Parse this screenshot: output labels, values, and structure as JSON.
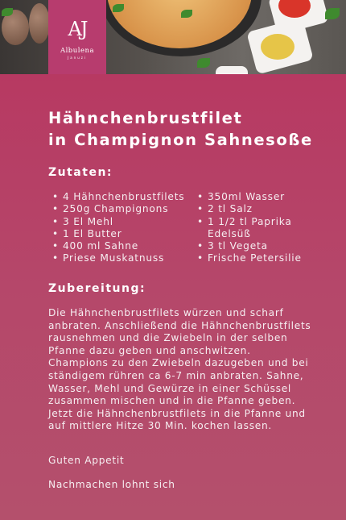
{
  "logo": {
    "monogram": "AJ",
    "name": "Albulena",
    "surname": "Januzi"
  },
  "title": {
    "line1": "Hähnchenbrustfilet",
    "line2": "in Champignon Sahnesoße"
  },
  "ingredients": {
    "heading": "Zutaten:",
    "column1": [
      "4 Hähnchenbrustfilets",
      "250g Champignons",
      "3 El Mehl",
      "1 El Butter",
      "400 ml Sahne",
      "Priese Muskatnuss"
    ],
    "column2": [
      "350ml Wasser",
      "2 tl Salz",
      "1 1/2 tl Paprika Edelsüß",
      "3 tl Vegeta",
      "Frische Petersilie"
    ]
  },
  "preparation": {
    "heading": "Zubereitung:",
    "text": "Die Hähnchenbrustfilets würzen und scharf anbraten. Anschließend die Hähnchenbrustfilets rausnehmen und die Zwiebeln in der selben Pfanne dazu geben und anschwitzen. Champions zu den Zwiebeln dazugeben und bei ständigem rühren ca 6-7 min anbraten. Sahne, Wasser, Mehl und Gewürze in einer Schüssel zusammen mischen und in die Pfanne geben. Jetzt die Hähnchenbrustfilets in die Pfanne und auf mittlere Hitze 30 Min. kochen lassen."
  },
  "closing1": "Guten Appetit",
  "closing2": "Nachmachen lohnt sich"
}
